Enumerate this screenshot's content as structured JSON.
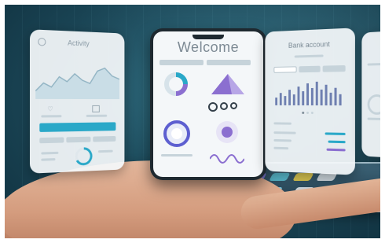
{
  "activity_card": {
    "title": "Activity",
    "button_label": ""
  },
  "welcome_phone": {
    "title": "Welcome"
  },
  "bank_card": {
    "title": "Bank account"
  },
  "colors": {
    "accent_teal": "#2aa8c8",
    "accent_purple": "#8b6fd0",
    "background": "#1d4b5c"
  },
  "icons": [
    "menu-icon",
    "heart-icon",
    "donut-chart-icon",
    "triangle-chart-icon",
    "gauge-icon",
    "toggle-icon"
  ]
}
